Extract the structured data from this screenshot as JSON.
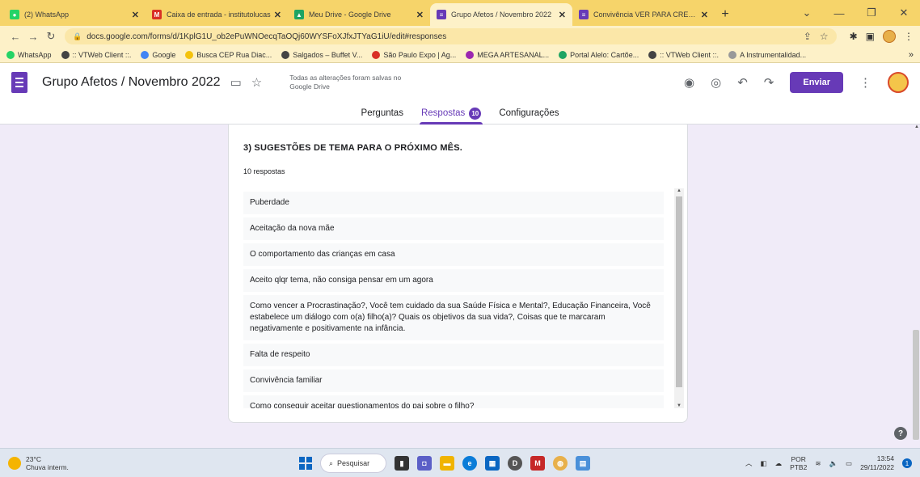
{
  "browser": {
    "tabs": [
      {
        "label": "(2) WhatsApp",
        "color": "#25d366",
        "glyph": "●"
      },
      {
        "label": "Caixa de entrada - institutolucas",
        "color": "#d93025",
        "glyph": "M"
      },
      {
        "label": "Meu Drive - Google Drive",
        "color": "#1fa463",
        "glyph": "▲"
      },
      {
        "label": "Grupo Afetos / Novembro 2022",
        "color": "#673ab7",
        "glyph": "≡"
      },
      {
        "label": "Convivência VER PARA CRER/No",
        "color": "#673ab7",
        "glyph": "≡"
      }
    ],
    "active_tab_index": 3,
    "url": "docs.google.com/forms/d/1KplG1U_ob2ePuWNOecqTaOQj60WYSFoXJfxJTYaG1iU/edit#responses",
    "bookmarks": [
      {
        "label": "WhatsApp",
        "color": "#25d366"
      },
      {
        "label": ":: VTWeb Client ::.",
        "color": "#444444"
      },
      {
        "label": "Google",
        "color": "#4285f4"
      },
      {
        "label": "Busca CEP Rua Diac...",
        "color": "#f4c20d"
      },
      {
        "label": "Salgados – Buffet V...",
        "color": "#444444"
      },
      {
        "label": "São Paulo Expo | Ag...",
        "color": "#d93025"
      },
      {
        "label": "MEGA ARTESANAL...",
        "color": "#9c27b0"
      },
      {
        "label": "Portal Alelo: Cartõe...",
        "color": "#1fa463"
      },
      {
        "label": ":: VTWeb Client ::.",
        "color": "#444444"
      },
      {
        "label": "A Instrumentalidad...",
        "color": "#999999"
      }
    ]
  },
  "form": {
    "title": "Grupo Afetos / Novembro 2022",
    "save_status": "Todas as alterações foram salvas no Google Drive",
    "send_label": "Enviar",
    "tabs": {
      "questions": "Perguntas",
      "responses": "Respostas",
      "responses_count": "10",
      "settings": "Configurações"
    },
    "question": {
      "title": "3) SUGESTÕES DE TEMA PARA O PRÓXIMO MÊS.",
      "count_text": "10 respostas",
      "answers": [
        "Puberdade",
        "Aceitação da nova mãe",
        "O comportamento das crianças em casa",
        "Aceito qlqr tema, não consiga pensar em um agora",
        "Como vencer a Procrastinação?, Você tem cuidado da sua Saúde Física e Mental?, Educação Financeira, Você estabelece um diálogo com o(a) filho(a)? Quais os objetivos da sua vida?, Coisas que te marcaram negativamente e positivamente na infância.",
        "Falta de respeito",
        "Convivência familiar",
        "Como conseguir aceitar questionamentos do pai sobre o filho?"
      ]
    }
  },
  "taskbar": {
    "temperature": "23°C",
    "weather": "Chuva interm.",
    "search_label": "Pesquisar",
    "lang_top": "POR",
    "lang_bottom": "PTB2",
    "time": "13:54",
    "date": "29/11/2022"
  },
  "colors": {
    "accent": "#673ab7",
    "page_bg": "#f0ebf8"
  }
}
